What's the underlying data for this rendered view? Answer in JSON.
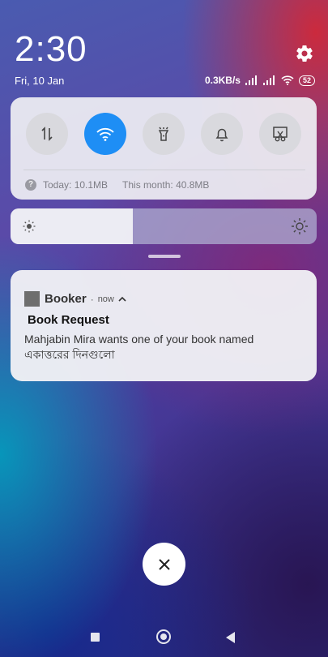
{
  "status": {
    "time": "2:30",
    "date": "Fri, 10 Jan",
    "net_speed": "0.3KB/s",
    "battery": "52"
  },
  "quick_settings": {
    "toggles": [
      {
        "name": "Mobile data",
        "icon": "data-transfer-icon",
        "active": false
      },
      {
        "name": "Wi-Fi",
        "icon": "wifi-icon",
        "active": true
      },
      {
        "name": "Flashlight",
        "icon": "flashlight-icon",
        "active": false
      },
      {
        "name": "Sound",
        "icon": "bell-icon",
        "active": false
      },
      {
        "name": "Screenshot",
        "icon": "scissors-icon",
        "active": false
      }
    ],
    "usage_today": "Today: 10.1MB",
    "usage_month": "This month: 40.8MB",
    "accent": "#1e8ef5"
  },
  "brightness": {
    "level": 0.4
  },
  "notification": {
    "app_name": "Booker",
    "time": "now",
    "title": "Book Request",
    "body_line1": "Mahjabin Mira wants one of your book named",
    "body_line2": "একাত্তরের দিনগুলো"
  }
}
